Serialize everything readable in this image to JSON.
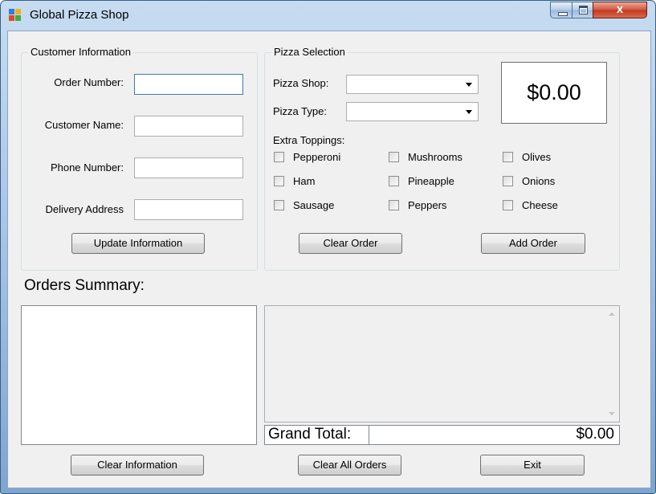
{
  "window": {
    "title": "Global Pizza Shop",
    "close_glyph": "x"
  },
  "customer": {
    "group_title": "Customer Information",
    "order_number_label": "Order Number:",
    "customer_name_label": "Customer Name:",
    "phone_number_label": "Phone Number:",
    "delivery_address_label": "Delivery Address",
    "order_number_value": "",
    "customer_name_value": "",
    "phone_number_value": "",
    "delivery_address_value": "",
    "update_button": "Update Information"
  },
  "pizza": {
    "group_title": "Pizza Selection",
    "shop_label": "Pizza Shop:",
    "type_label": "Pizza Type:",
    "shop_value": "",
    "type_value": "",
    "price": "$0.00",
    "toppings_label": "Extra Toppings:",
    "toppings": [
      "Pepperoni",
      "Mushrooms",
      "Olives",
      "Ham",
      "Pineapple",
      "Onions",
      "Sausage",
      "Peppers",
      "Cheese"
    ],
    "clear_order_button": "Clear Order",
    "add_order_button": "Add Order"
  },
  "summary": {
    "title": "Orders Summary:",
    "grand_total_label": "Grand Total:",
    "grand_total_value": "$0.00"
  },
  "footer": {
    "clear_information_button": "Clear Information",
    "clear_all_orders_button": "Clear All Orders",
    "exit_button": "Exit"
  },
  "colors": {
    "title_gradient_top": "#c7dcf1",
    "client_bg": "#f0f0f0",
    "close_red": "#c0391f"
  }
}
